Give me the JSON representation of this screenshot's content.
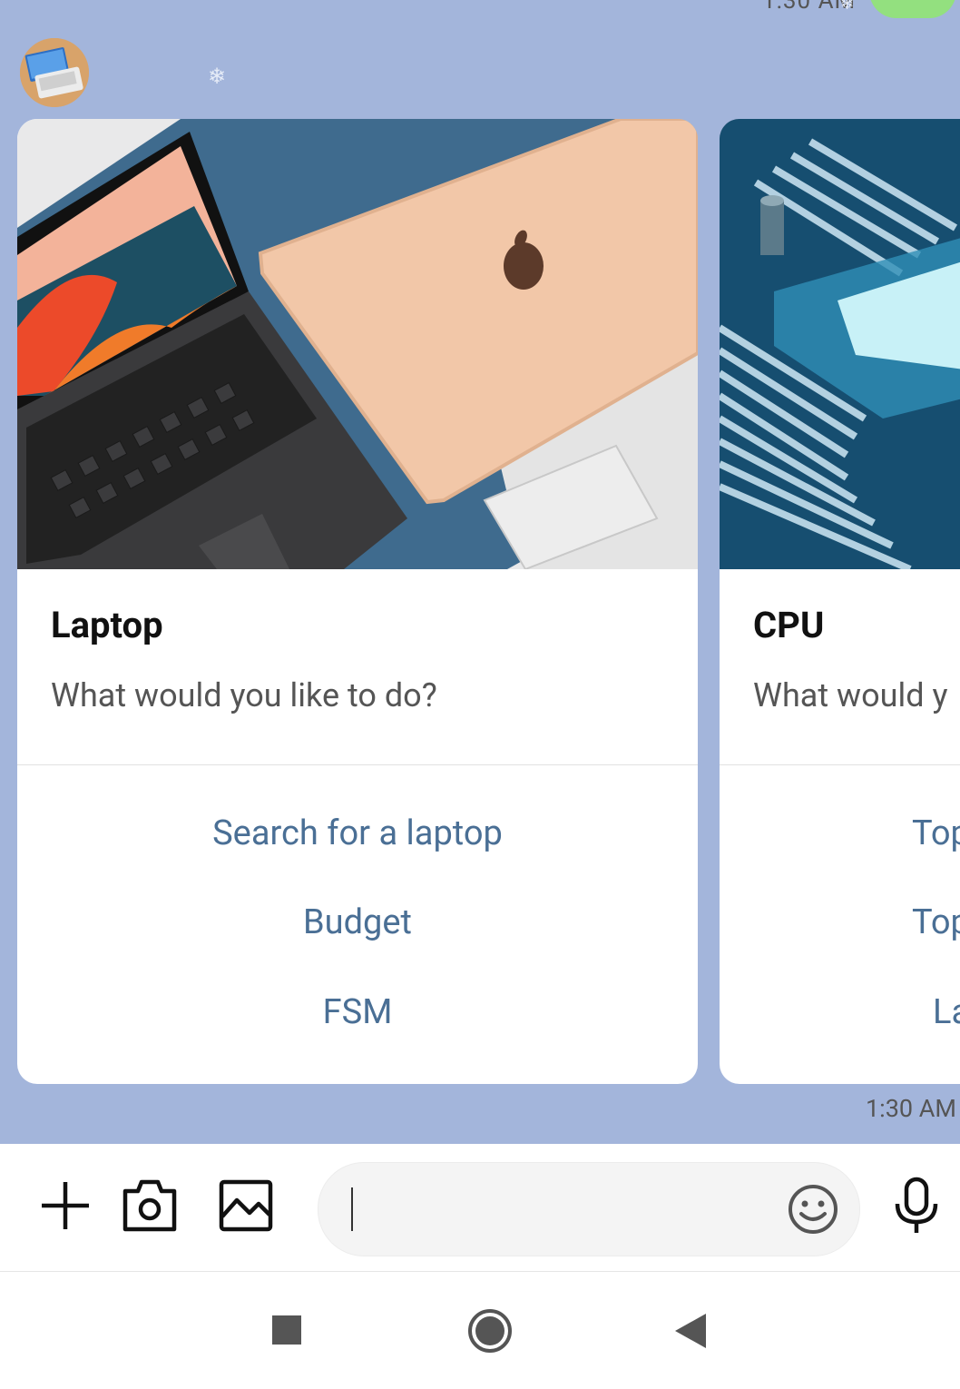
{
  "chat": {
    "previous_time": "1:30 AM",
    "message_time": "1:30 AM"
  },
  "cards": [
    {
      "title": "Laptop",
      "subtitle": "What would you like to do?",
      "actions": [
        "Search for a laptop",
        "Budget",
        "FSM"
      ]
    },
    {
      "title": "CPU",
      "subtitle": "What would y",
      "actions": [
        "Top",
        "Top",
        "La"
      ]
    }
  ],
  "input": {
    "value": "",
    "icons": [
      "plus-icon",
      "camera-icon",
      "image-icon",
      "emoji-icon",
      "microphone-icon"
    ]
  },
  "navigation": {
    "icons": [
      "recents-square-icon",
      "home-circle-icon",
      "back-triangle-icon"
    ]
  },
  "colors": {
    "chat_background": "#a3b5db",
    "link_text": "#4a6f95",
    "sent_bubble": "#93e07f"
  }
}
